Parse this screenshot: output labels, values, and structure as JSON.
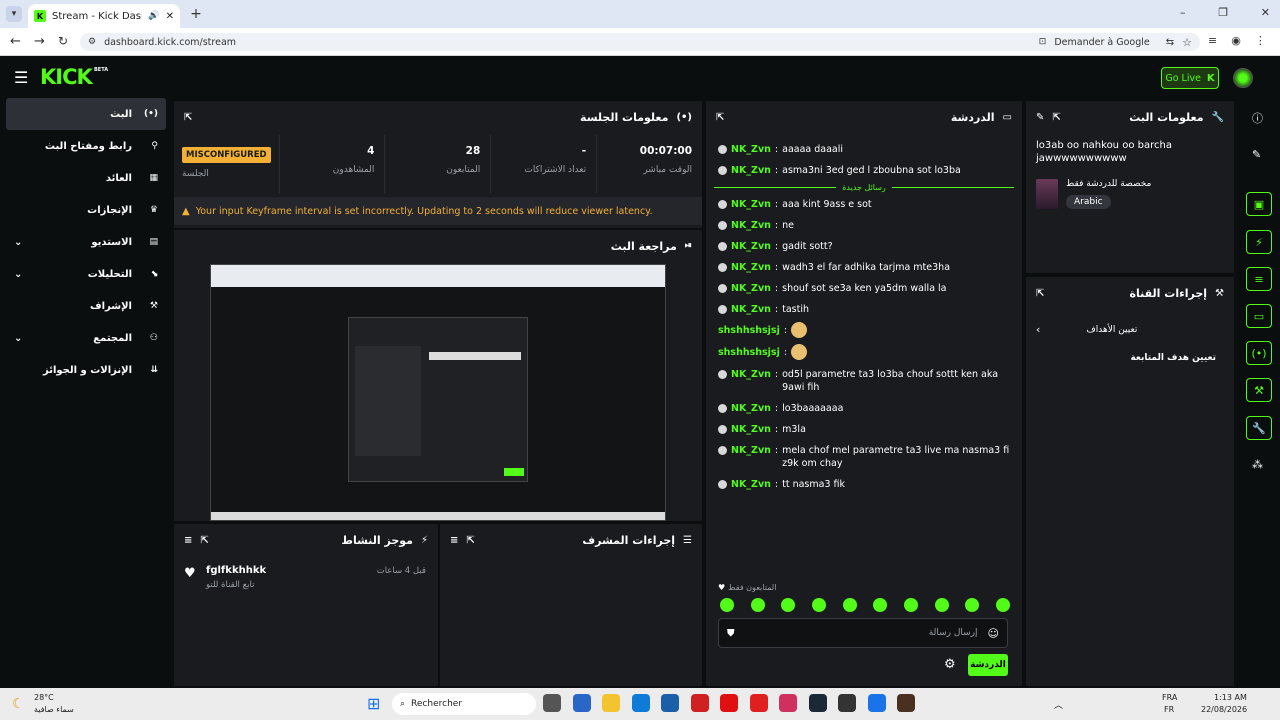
{
  "browser": {
    "tab_title": "Stream - Kick Dashboard",
    "url": "dashboard.kick.com/stream",
    "ask_google": "Demander à Google"
  },
  "kick": {
    "logo": "KICK",
    "beta": "BETA",
    "go_live": "Go Live"
  },
  "sidebar": {
    "items": [
      {
        "label": "البث",
        "icon": "broadcast-icon"
      },
      {
        "label": "رابط ومفتاح البث",
        "icon": "link-icon"
      },
      {
        "label": "العائد",
        "icon": "dollar-icon"
      },
      {
        "label": "الإنجازات",
        "icon": "trophy-icon"
      },
      {
        "label": "الاستديو",
        "icon": "studio-icon"
      },
      {
        "label": "التحليلات",
        "icon": "analytics-icon"
      },
      {
        "label": "الإشراف",
        "icon": "wrench-icon"
      },
      {
        "label": "المجتمع",
        "icon": "community-icon"
      },
      {
        "label": "الإنزالات و الجوائز",
        "icon": "drops-icon"
      }
    ]
  },
  "session": {
    "title": "معلومات الجلسة",
    "badge": "MISCONFIGURED",
    "session_label": "الجلسة",
    "viewers_value": "4",
    "viewers_label": "المشاهدون",
    "followers_value": "28",
    "followers_label": "المتابعون",
    "subs_value": "-",
    "subs_label": "تعداد الاشتراكات",
    "live_value": "00:07:00",
    "live_label": "الوقت مباشر",
    "warning": "Your input Keyframe interval is set incorrectly. Updating to 2 seconds will reduce viewer latency."
  },
  "preview": {
    "title": "مراجعة البث"
  },
  "activity": {
    "title": "موجز النشاط",
    "user": "fglfkkhhkk",
    "time": "قبل 4 ساعات",
    "desc": "تابع القناة للتو"
  },
  "modactions": {
    "title": "إجراءات المشرف"
  },
  "chat": {
    "title": "الدردشة",
    "new_messages": "رسائل جديدة",
    "messages": [
      {
        "user": "NK_Zvn",
        "text": "aaaaa daaali",
        "type": "nk"
      },
      {
        "user": "NK_Zvn",
        "text": "asma3ni 3ed ged l zboubna sot lo3ba",
        "type": "nk"
      },
      {
        "user": "NK_Zvn",
        "text": "aaa kint 9ass e sot",
        "type": "nk"
      },
      {
        "user": "NK_Zvn",
        "text": "ne",
        "type": "nk"
      },
      {
        "user": "NK_Zvn",
        "text": "gadit sott?",
        "type": "nk"
      },
      {
        "user": "NK_Zvn",
        "text": "wadh3 el far adhika tarjma mte3ha",
        "type": "nk"
      },
      {
        "user": "NK_Zvn",
        "text": "shouf sot se3a ken ya5dm walla la",
        "type": "nk"
      },
      {
        "user": "NK_Zvn",
        "text": "tastih",
        "type": "nk"
      },
      {
        "user": "shshhshsjsj",
        "text": "",
        "type": "emote"
      },
      {
        "user": "shshhshsjsj",
        "text": "",
        "type": "emote"
      },
      {
        "user": "NK_Zvn",
        "text": "od5l parametre ta3 lo3ba chouf sottt ken aka 9awi fih",
        "type": "nk"
      },
      {
        "user": "NK_Zvn",
        "text": "lo3baaaaaaa",
        "type": "nk"
      },
      {
        "user": "NK_Zvn",
        "text": "m3la",
        "type": "nk"
      },
      {
        "user": "NK_Zvn",
        "text": "mela chof mel parametre ta3 live ma nasma3 fi z9k om chay",
        "type": "nk"
      },
      {
        "user": "NK_Zvn",
        "text": "tt nasma3 fik",
        "type": "nk"
      }
    ],
    "followers_only": "المتابعون فقط",
    "input_placeholder": "إرسال رسالة",
    "send_label": "الدردشة"
  },
  "stream_info": {
    "title": "معلومات البث",
    "stream_title": "lo3ab oo nahkou oo barcha jawwwwwwwwww",
    "category": "مخصصة للدردشة فقط",
    "language": "Arabic"
  },
  "channel_actions": {
    "title": "إجراءات القناة",
    "goal_item": "تعيين الأهداف",
    "follow_goal": "تعيين هدف المتابعة"
  },
  "taskbar": {
    "weather_temp": "28°C",
    "weather_desc": "سماء صافية",
    "search": "Rechercher",
    "lang1": "FRA",
    "lang2": "FR",
    "time": "1:13 AM",
    "date": "22/08/2026"
  },
  "colors": {
    "accent": "#53fc18",
    "warning": "#f2b134",
    "panel": "#191b1f"
  }
}
